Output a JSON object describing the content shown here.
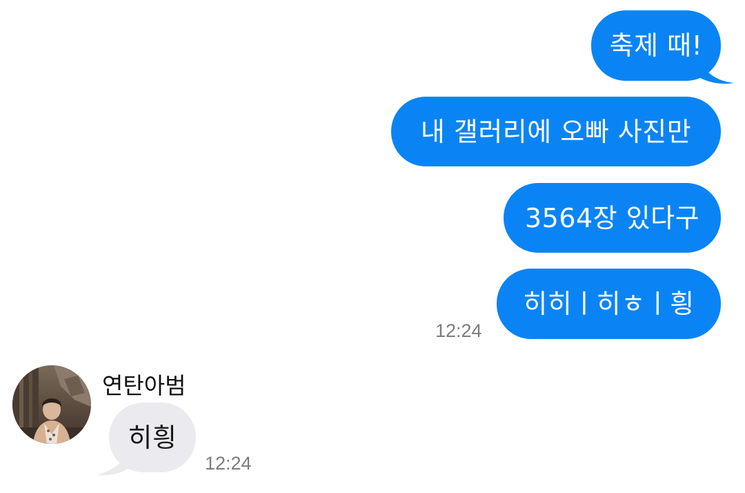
{
  "chat": {
    "outgoing": [
      {
        "text": "축제 때!"
      },
      {
        "text": "내 갤러리에 오빠 사진만"
      },
      {
        "text": "3564장 있다구"
      },
      {
        "text": "히히ㅣ히ㅎㅣ힁"
      }
    ],
    "outgoing_time": "12:24",
    "incoming": {
      "sender": "연탄아범",
      "text": "히힁",
      "time": "12:24"
    }
  },
  "colors": {
    "outgoing_bubble": "#0a84f5",
    "incoming_bubble": "#ebebef",
    "timestamp": "#7c7c7c"
  },
  "icons": {
    "avatar": "profile-photo"
  }
}
